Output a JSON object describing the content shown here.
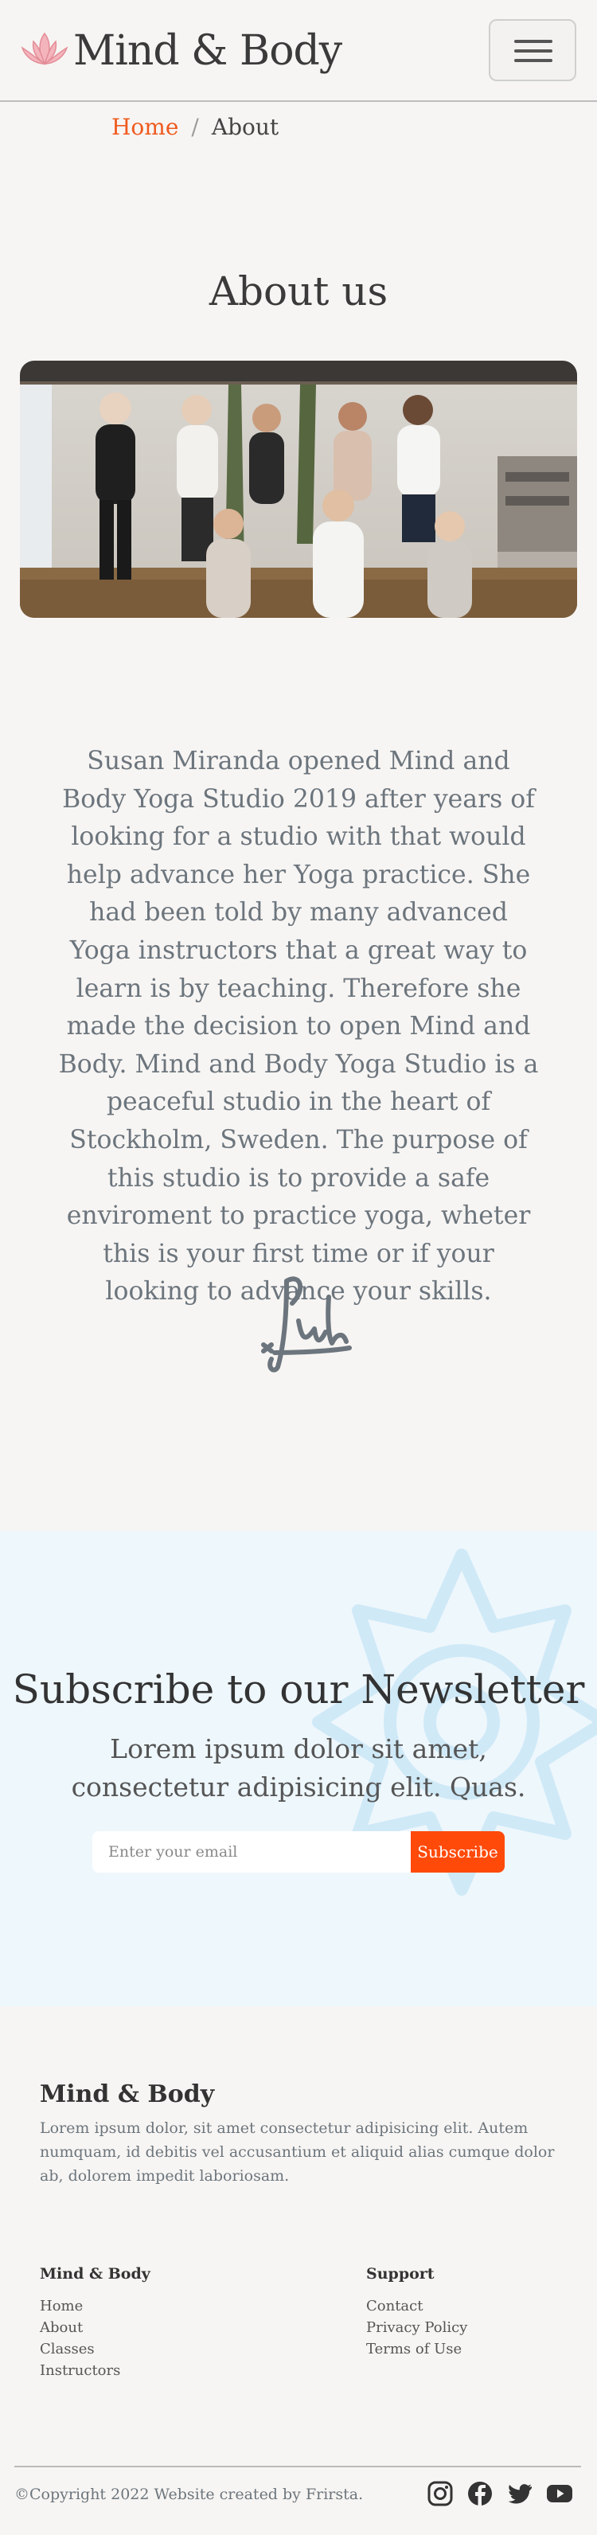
{
  "header": {
    "brand": "Mind & Body",
    "logo_icon": "lotus-icon",
    "menu_icon": "hamburger-menu-icon"
  },
  "breadcrumb": {
    "home": "Home",
    "separator": "/",
    "current": "About"
  },
  "about": {
    "title": "About us",
    "image": "yoga-group-photo",
    "story": "Susan Miranda opened Mind and Body Yoga Studio 2019 after years of looking for a studio with that would help advance her Yoga practice. She had been told by many advanced Yoga instructors that a great way to learn is by teaching. Therefore she made the decision to open Mind and Body. Mind and Body Yoga Studio is a peaceful studio in the heart of Stockholm, Sweden. The purpose of this studio is to provide a safe enviroment to practice yoga, wheter this is your first time or if your looking to advance your skills.",
    "signature_icon": "signature-icon"
  },
  "newsletter": {
    "title": "Subscribe to our Newsletter",
    "subtitle": "Lorem ipsum dolor sit amet, consectetur adipisicing elit. Quas.",
    "email_placeholder": "Enter your email",
    "button": "Subscribe"
  },
  "footer": {
    "brand": "Mind & Body",
    "description": "Lorem ipsum dolor, sit amet consectetur adipisicing elit. Autem numquam, id debitis vel accusantium et aliquid alias cumque dolor ab, dolorem impedit laboriosam.",
    "columns": [
      {
        "title": "Mind & Body",
        "links": [
          "Home",
          "About",
          "Classes",
          "Instructors"
        ]
      },
      {
        "title": "Support",
        "links": [
          "Contact",
          "Privacy Policy",
          "Terms of Use"
        ]
      }
    ],
    "copyright": "©Copyright 2022 Website created by Frirsta.",
    "social": [
      "instagram-icon",
      "facebook-icon",
      "twitter-icon",
      "youtube-icon"
    ]
  },
  "colors": {
    "accent": "#ef5a1f",
    "button": "#ff4a0a",
    "background": "#f7f5f3",
    "newsletter_bg": "#eef7fc",
    "muted_text": "#6c757d"
  }
}
